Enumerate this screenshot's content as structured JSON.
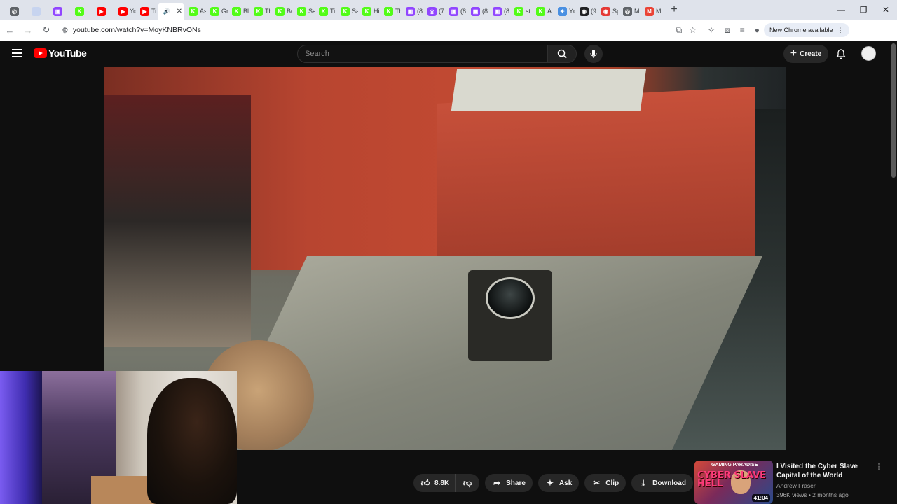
{
  "browser": {
    "tabs": [
      {
        "label": "",
        "favicon_color": "#5f6368",
        "glyph": "◎"
      },
      {
        "label": "",
        "favicon_color": "#c7d4ef",
        "glyph": ""
      },
      {
        "label": "",
        "favicon_color": "#9146ff",
        "glyph": "▣"
      },
      {
        "label": "",
        "favicon_color": "#53fc18",
        "glyph": "K"
      },
      {
        "label": "",
        "favicon_color": "#ff0000",
        "glyph": "▶"
      },
      {
        "label": "Yo",
        "favicon_color": "#ff0000",
        "glyph": "▶"
      },
      {
        "label": "Tr",
        "favicon_color": "#ff0000",
        "glyph": "▶"
      },
      {
        "label": "",
        "favicon_color": "#ffffff",
        "glyph": "🔊",
        "active": true
      },
      {
        "label": "As",
        "favicon_color": "#53fc18",
        "glyph": "K"
      },
      {
        "label": "Gr",
        "favicon_color": "#53fc18",
        "glyph": "K"
      },
      {
        "label": "Bl",
        "favicon_color": "#53fc18",
        "glyph": "K"
      },
      {
        "label": "Th",
        "favicon_color": "#53fc18",
        "glyph": "K"
      },
      {
        "label": "Bo",
        "favicon_color": "#53fc18",
        "glyph": "K"
      },
      {
        "label": "Sa",
        "favicon_color": "#53fc18",
        "glyph": "K"
      },
      {
        "label": "Ti",
        "favicon_color": "#53fc18",
        "glyph": "K"
      },
      {
        "label": "Sa",
        "favicon_color": "#53fc18",
        "glyph": "K"
      },
      {
        "label": "Hi",
        "favicon_color": "#53fc18",
        "glyph": "K"
      },
      {
        "label": "Th",
        "favicon_color": "#53fc18",
        "glyph": "K"
      },
      {
        "label": "(8",
        "favicon_color": "#9146ff",
        "glyph": "▣"
      },
      {
        "label": "(7",
        "favicon_color": "#9146ff",
        "glyph": "◎"
      },
      {
        "label": "(8",
        "favicon_color": "#9146ff",
        "glyph": "▣"
      },
      {
        "label": "(8",
        "favicon_color": "#9146ff",
        "glyph": "▣"
      },
      {
        "label": "(8",
        "favicon_color": "#9146ff",
        "glyph": "▣"
      },
      {
        "label": "st",
        "favicon_color": "#53fc18",
        "glyph": "K"
      },
      {
        "label": "A",
        "favicon_color": "#53fc18",
        "glyph": "K"
      },
      {
        "label": "Yc",
        "favicon_color": "#4a90e2",
        "glyph": "✦"
      },
      {
        "label": "(9",
        "favicon_color": "#202124",
        "glyph": "◉"
      },
      {
        "label": "Sp",
        "favicon_color": "#e53935",
        "glyph": "◉"
      },
      {
        "label": "M",
        "favicon_color": "#5f6368",
        "glyph": "◎"
      },
      {
        "label": "M",
        "favicon_color": "#ea4335",
        "glyph": "M"
      }
    ],
    "url": "youtube.com/watch?v=MoyKNBRvONs",
    "new_chrome_label": "New Chrome available"
  },
  "youtube": {
    "logo_text": "YouTube",
    "search_placeholder": "Search",
    "create_label": "Create"
  },
  "actions": {
    "like_count": "8.8K",
    "share_label": "Share",
    "ask_label": "Ask",
    "clip_label": "Clip",
    "download_label": "Download"
  },
  "recommended": {
    "title": "I Visited the Cyber Slave Capital of the World",
    "channel": "Andrew Fraser",
    "meta": "396K views • 2 months ago",
    "duration": "41:04",
    "thumb_text_top": "GAMING PARADISE",
    "thumb_text_main": "CYBER SLAVE HELL"
  },
  "colors": {
    "yt_red": "#ff0000",
    "bg": "#0f0f0f",
    "pill": "#272727"
  }
}
